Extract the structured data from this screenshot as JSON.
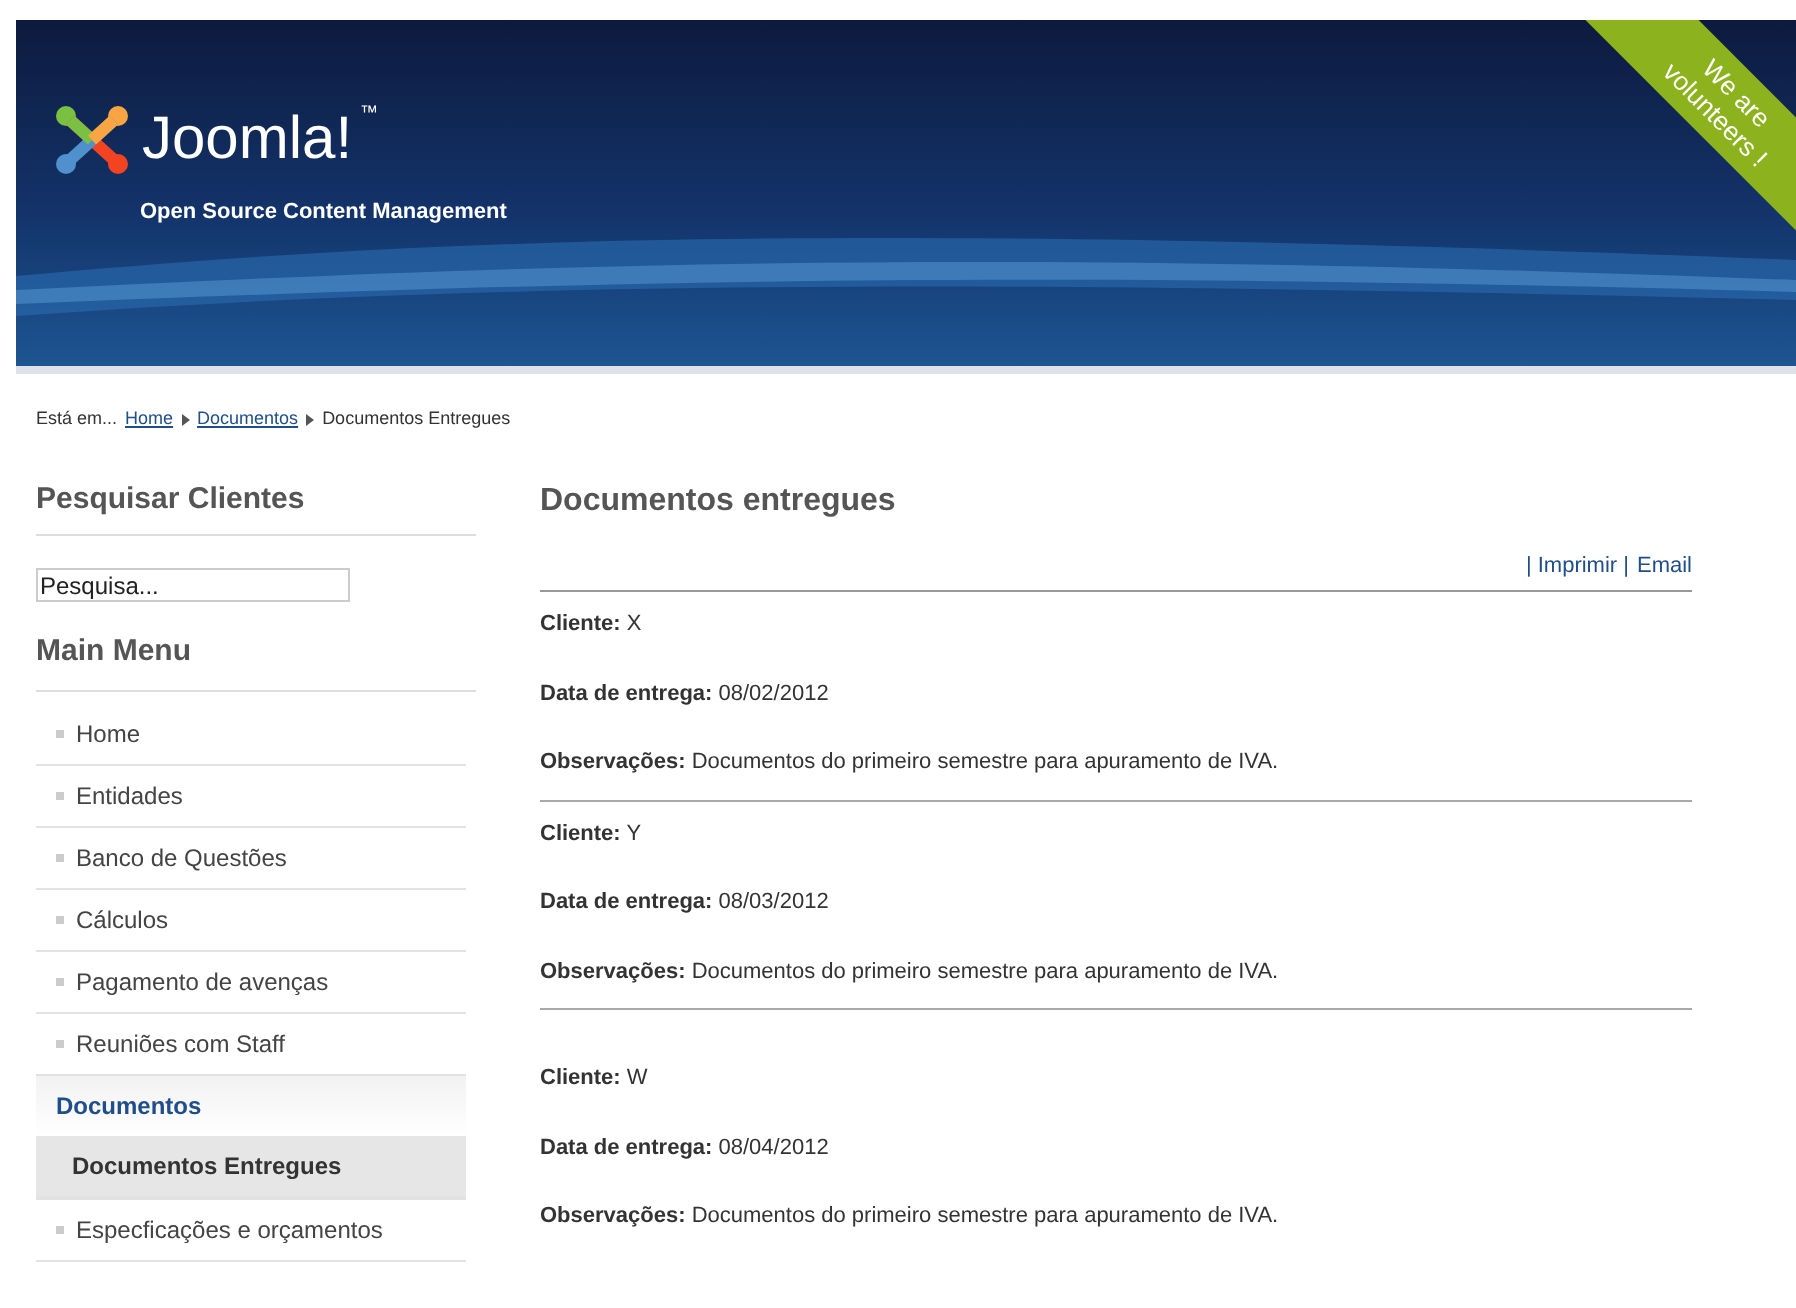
{
  "header": {
    "logo_text": "Joomla!",
    "trademark": "™",
    "tagline": "Open Source Content Management",
    "ribbon": "We are volunteers !"
  },
  "breadcrumb": {
    "prefix": "Está em...",
    "links": [
      "Home",
      "Documentos"
    ],
    "current": "Documentos Entregues"
  },
  "sidebar": {
    "search_title": "Pesquisar Clientes",
    "search": {
      "value": "Pesquisa..."
    },
    "menu_title": "Main Menu",
    "items": [
      {
        "label": "Home",
        "selected": false
      },
      {
        "label": "Entidades",
        "selected": false
      },
      {
        "label": "Banco de Questões",
        "selected": false
      },
      {
        "label": "Cálculos",
        "selected": false
      },
      {
        "label": "Pagamento de avenças",
        "selected": false
      },
      {
        "label": "Reuniões com Staff",
        "selected": false
      },
      {
        "label": "Documentos",
        "selected": false,
        "children": [
          {
            "label": "Documentos Entregues",
            "selected": true
          }
        ]
      },
      {
        "label": "Especficações e orçamentos",
        "selected": false
      }
    ]
  },
  "main": {
    "title": "Documentos entregues",
    "actions": [
      "| Imprimir |",
      "Email"
    ],
    "records": [
      {
        "lines": [
          "**Cliente:** X",
          "**Data de entrega:** 08/02/2012",
          "**Observações:**  Documentos do primeiro semestre para apuramento de IVA."
        ]
      },
      {
        "lines": [
          "**Cliente:** Y",
          "**Data de entrega:** 08/03/2012",
          "**Observações:**  Documentos do primeiro semestre para apuramento de IVA."
        ]
      },
      {
        "lines": [
          "**Cliente:** W",
          "**Data de entrega:** 08/04/2012",
          "**Observações:**  Documentos do primeiro semestre para apuramento de IVA."
        ]
      }
    ]
  }
}
